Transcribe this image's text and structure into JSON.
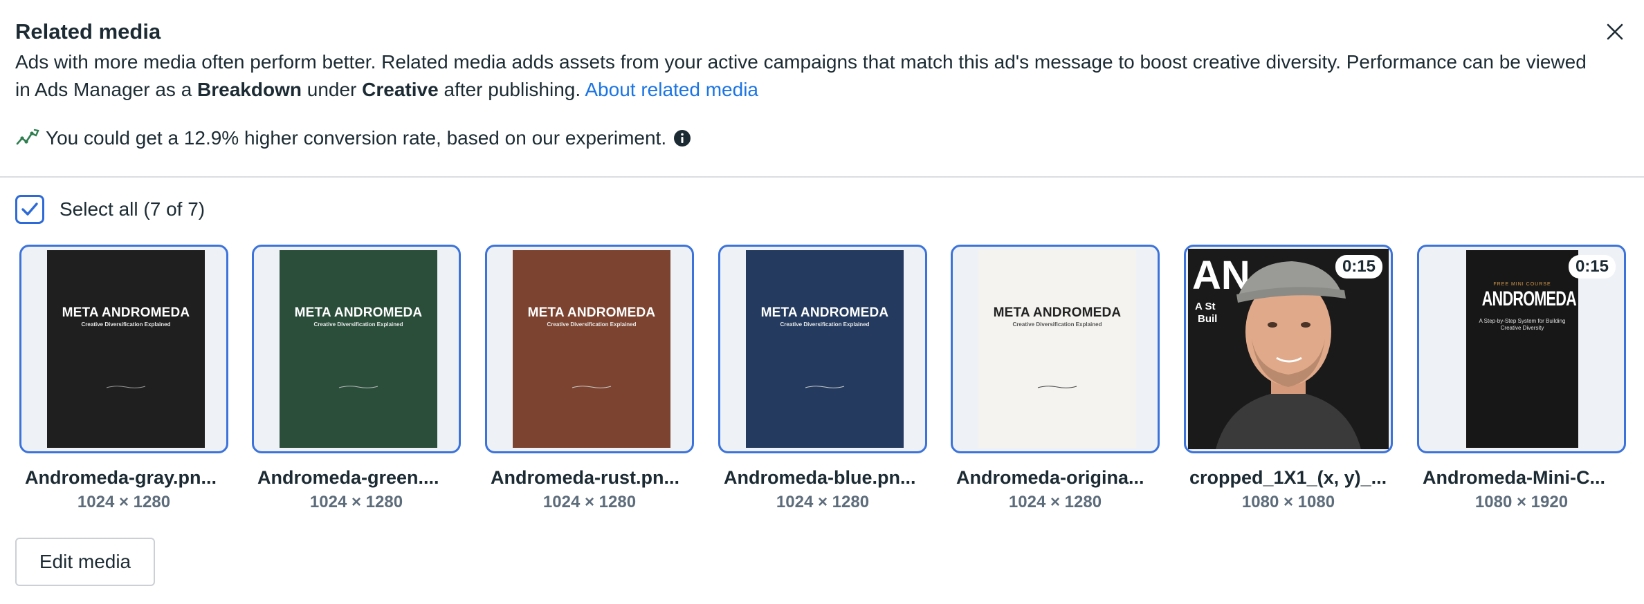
{
  "header": {
    "title": "Related media",
    "desc_part1": "Ads with more media often perform better. Related media adds assets from your active campaigns that match this ad's message to boost creative diversity. Performance can be viewed in Ads Manager as a ",
    "desc_bold1": "Breakdown",
    "desc_mid": " under ",
    "desc_bold2": "Creative",
    "desc_part2": " after publishing. ",
    "desc_link": "About related media"
  },
  "insight": {
    "text": "You could get a 12.9% higher conversion rate, based on our experiment.",
    "icon": "trend-up-icon",
    "info_icon": "info-icon"
  },
  "select_all": {
    "label": "Select all (7 of 7)",
    "checked": true
  },
  "media": [
    {
      "name": "Andromeda-gray.pn...",
      "dims": "1024 × 1280",
      "bg": "#1f1f1f",
      "poster_title": "META ANDROMEDA",
      "poster_sub": "Creative Diversification Explained"
    },
    {
      "name": "Andromeda-green....",
      "dims": "1024 × 1280",
      "bg": "#2a4e3a",
      "poster_title": "META ANDROMEDA",
      "poster_sub": "Creative Diversification Explained"
    },
    {
      "name": "Andromeda-rust.pn...",
      "dims": "1024 × 1280",
      "bg": "#7c4430",
      "poster_title": "META ANDROMEDA",
      "poster_sub": "Creative Diversification Explained"
    },
    {
      "name": "Andromeda-blue.pn...",
      "dims": "1024 × 1280",
      "bg": "#243b5f",
      "poster_title": "META ANDROMEDA",
      "poster_sub": "Creative Diversification Explained"
    },
    {
      "name": "Andromeda-origina...",
      "dims": "1024 × 1280",
      "bg": "#f4f3ef",
      "poster_title": "META ANDROMEDA",
      "poster_sub": "Creative Diversification Explained"
    },
    {
      "name": "cropped_1X1_(x, y)_...",
      "dims": "1080 × 1080",
      "duration": "0:15"
    },
    {
      "name": "Andromeda-Mini-C...",
      "dims": "1080 × 1920",
      "duration": "0:15",
      "poster_kicker": "FREE MINI COURSE",
      "poster_title": "ANDROMEDA",
      "poster_sub": "A Step-by-Step System for Building Creative Diversity"
    }
  ],
  "edit_button": "Edit media",
  "colors": {
    "accent": "#1b74e4",
    "tile_border": "#3b73db",
    "checkbox": "#2d6ad8"
  }
}
